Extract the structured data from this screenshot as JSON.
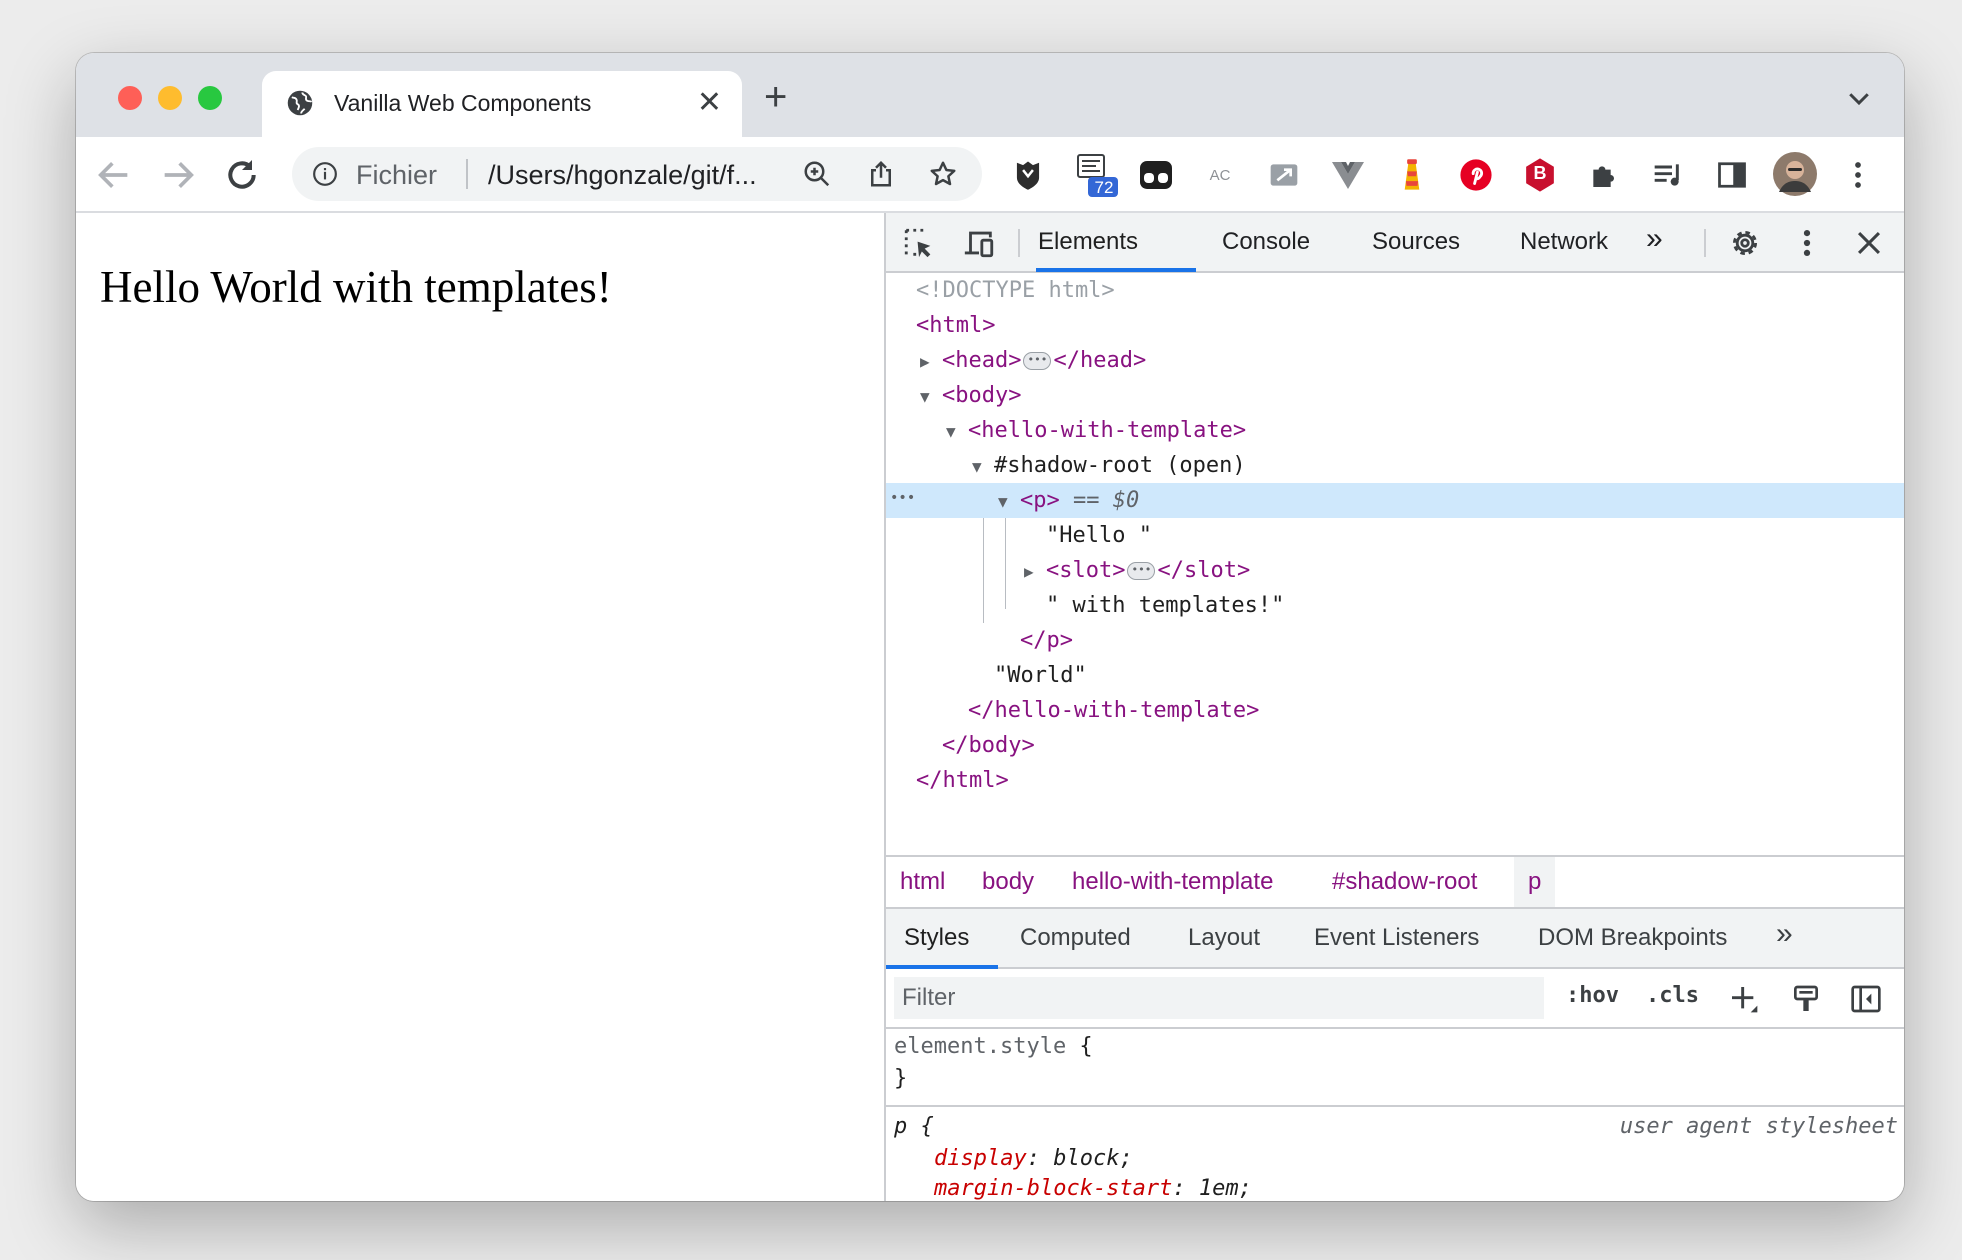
{
  "window": {
    "traffic_lights": {
      "close": "#fe5f57",
      "minimize": "#febc2e",
      "zoom": "#28c840"
    }
  },
  "tab": {
    "title": "Vanilla Web Components",
    "close": "✕",
    "favicon": "globe-icon"
  },
  "new_tab": "+",
  "toolbar": {
    "scheme_label": "Fichier",
    "url": "/Users/hgonzale/git/f...",
    "badge_count": "72",
    "ac_label": "AC",
    "honey_letter": "B"
  },
  "page": {
    "heading": "Hello World with templates!"
  },
  "devtools": {
    "tabs": [
      "Elements",
      "Console",
      "Sources",
      "Network"
    ],
    "more": "»",
    "dom": {
      "doctype": "<!DOCTYPE html>",
      "html_open": "<html>",
      "head_open": "<head>",
      "head_close": "</head>",
      "body_open": "<body>",
      "hello_open": "<hello-with-template>",
      "shadow_root": "#shadow-root (open)",
      "p_open": "<p>",
      "p_marker": "== $0",
      "text_hello": "\"Hello \"",
      "slot_open": "<slot>",
      "slot_close": "</slot>",
      "text_with": "\" with templates!\"",
      "p_close": "</p>",
      "text_world": "\"World\"",
      "hello_close": "</hello-with-template>",
      "body_close": "</body>",
      "html_close": "</html>",
      "gutter_dots": "•••"
    },
    "breadcrumbs": [
      "html",
      "body",
      "hello-with-template",
      "#shadow-root",
      "p"
    ],
    "styles_tabs": [
      "Styles",
      "Computed",
      "Layout",
      "Event Listeners",
      "DOM Breakpoints"
    ],
    "filter_placeholder": "Filter",
    "hov": ":hov",
    "cls": ".cls",
    "rules": {
      "element_style": "element.style",
      "open_brace": " {",
      "close_brace": "}",
      "p_selector": "p",
      "p_open": " {",
      "source": "user agent stylesheet",
      "decl1_name": "display",
      "decl1_value": "block;",
      "decl2_name": "margin-block-start",
      "decl2_value": "1em;"
    }
  }
}
